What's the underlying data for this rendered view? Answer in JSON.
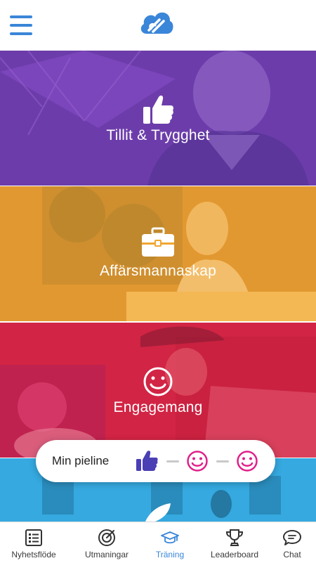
{
  "header": {
    "menu_icon": "hamburger-menu-icon",
    "logo_icon": "cloud-logo-icon"
  },
  "cards": [
    {
      "label": "Tillit & Trygghet",
      "icon": "thumbs-up-icon",
      "tint": "#7c3fc4"
    },
    {
      "label": "Affärsmannaskap",
      "icon": "briefcase-icon",
      "tint": "#f0a632"
    },
    {
      "label": "Engagemang",
      "icon": "smiley-icon",
      "tint": "#e2284a"
    },
    {
      "label": "",
      "icon": "rocket-icon",
      "tint": "#35a9e0"
    }
  ],
  "pipeline": {
    "title": "Min pieline",
    "icons": [
      "thumbs-up-icon",
      "smiley-icon",
      "smiley-icon"
    ],
    "colors": [
      "#4a3fb4",
      "#e0208a",
      "#e0208a"
    ]
  },
  "bottom_nav": {
    "items": [
      {
        "label": "Nyhetsflöde",
        "icon": "news-list-icon"
      },
      {
        "label": "Utmaningar",
        "icon": "target-icon"
      },
      {
        "label": "Träning",
        "icon": "graduation-cap-icon",
        "active": true
      },
      {
        "label": "Leaderboard",
        "icon": "trophy-icon"
      },
      {
        "label": "Chat",
        "icon": "chat-bubble-icon"
      }
    ],
    "active_color": "#3a86d8"
  }
}
